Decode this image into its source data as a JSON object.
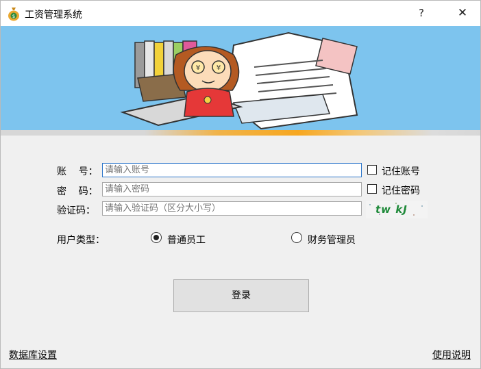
{
  "window": {
    "title": "工资管理系统",
    "help_label": "?",
    "close_label": "✕"
  },
  "form": {
    "account_label": "账    号：",
    "account_placeholder": "请输入账号",
    "password_label": "密    码：",
    "password_placeholder": "请输入密码",
    "captcha_label": "验证码：",
    "captcha_placeholder": "请输入验证码（区分大小写）",
    "captcha_text": "tw kJ",
    "remember_account_label": "记住账号",
    "remember_password_label": "记住密码",
    "remember_account_checked": false,
    "remember_password_checked": false
  },
  "user_type": {
    "label": "用户类型：",
    "options": [
      {
        "label": "普通员工",
        "selected": true
      },
      {
        "label": "财务管理员",
        "selected": false
      }
    ]
  },
  "login_button": "登录",
  "footer": {
    "db_settings_link": "数据库设置",
    "help_link": "使用说明"
  },
  "colors": {
    "banner_bg": "#7dc4ee",
    "accent_strip": "#f7a720",
    "focus_border": "#2a74c9"
  }
}
